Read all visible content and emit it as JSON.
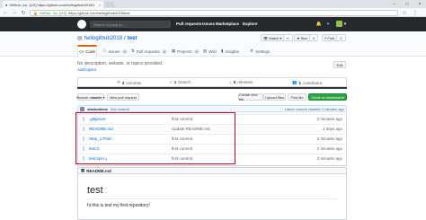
{
  "browser": {
    "tab_title": "GitHub, Inc. [US] https://github.com/hellogithub2018/test",
    "tab_close": "×",
    "url": "https://github.com/hellogithub2018/test",
    "secure_label": "GitHub, Inc. [US]"
  },
  "github_header": {
    "search_placeholder": "Search or jump to...",
    "nav": [
      "Pull requests",
      "Issues",
      "Marketplace",
      "Explore"
    ]
  },
  "repo": {
    "owner": "hellogithub2018",
    "separator": "/",
    "name": "test",
    "watch_label": "Watch",
    "watch_count": "0",
    "star_label": "Star",
    "star_count": "0",
    "fork_label": "Fork",
    "fork_count": "0"
  },
  "tabs": [
    {
      "label": "Code"
    },
    {
      "label": "Issues",
      "count": "0"
    },
    {
      "label": "Pull requests",
      "count": "0"
    },
    {
      "label": "Projects",
      "count": "0"
    },
    {
      "label": "Wiki"
    },
    {
      "label": "Insights"
    },
    {
      "label": "Settings"
    }
  ],
  "description": {
    "text": "No description, website, or topics provided.",
    "topics_link": "Add topics",
    "edit_label": "Edit"
  },
  "summary": {
    "commits": "3",
    "commits_label": "commits",
    "branches": "1",
    "branches_label": "branch",
    "releases": "0",
    "releases_label": "releases",
    "contributors": "1",
    "contributors_label": "contributor",
    "language_fill": 1.0
  },
  "file_nav": {
    "branch_label": "Branch:",
    "branch_value": "master",
    "new_pr": "New pull request",
    "create_file": "Create new file",
    "upload": "Upload files",
    "find": "Find file",
    "clone": "Clone or download"
  },
  "commit_tease": {
    "author": "xiaokobianc",
    "message": "first commit",
    "latest": "Latest commit cbaafcb 2 minutes ago"
  },
  "files": [
    {
      "icon": "file-icon",
      "name": ".gitignore",
      "message": "first commit",
      "age": "2 minutes ago"
    },
    {
      "icon": "file-icon",
      "name": "README.md",
      "message": "Update README.md",
      "age": "3 days ago"
    },
    {
      "icon": "file-icon",
      "name": "Step_1.PNG",
      "message": "first commit",
      "age": "2 minutes ago"
    },
    {
      "icon": "file-icon",
      "name": "test.h",
      "message": "first commit",
      "age": "2 minutes ago"
    },
    {
      "icon": "file-icon",
      "name": "test.hpro.j",
      "message": "first commit",
      "age": "2 minutes ago"
    }
  ],
  "readme": {
    "header": "README.md",
    "title": "test",
    "text": "hi this is test my first repository!"
  },
  "colors": {
    "header_bg": "#24292e",
    "link": "#0366d6",
    "green": "#28a745",
    "highlight_box": "#d0021b"
  }
}
